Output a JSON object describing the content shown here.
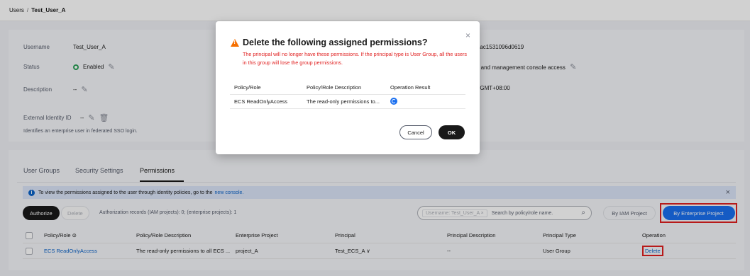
{
  "breadcrumb": {
    "parent": "Users",
    "separator": "/",
    "current": "Test_User_A"
  },
  "info": {
    "username_label": "Username",
    "username_value": "Test_User_A",
    "status_label": "Status",
    "status_value": "Enabled",
    "description_label": "Description",
    "description_value": "--",
    "external_id_label": "External Identity ID",
    "external_id_value": "--",
    "sso_hint": "Identifies an enterprise user in federated SSO login.",
    "right_id_partial": "b9aac1531096d0619",
    "right_access_partial": "ess and management console access",
    "right_time_partial": ":10 GMT+08:00"
  },
  "tabs": [
    {
      "label": "User Groups"
    },
    {
      "label": "Security Settings"
    },
    {
      "label": "Permissions"
    }
  ],
  "banner": {
    "text": "To view the permissions assigned to the user through identity policies, go to the",
    "link": "new console."
  },
  "toolbar": {
    "authorize_label": "Authorize",
    "delete_label": "Delete",
    "records": "Authorization records (IAM projects): 0; (enterprise projects): 1",
    "search_chip": "Username: Test_User_A  ×",
    "search_placeholder": "Search by policy/role name.",
    "by_iam_label": "By IAM Project",
    "by_ep_label": "By Enterprise Project"
  },
  "table": {
    "headers": [
      "Policy/Role ⊜",
      "Policy/Role Description",
      "Enterprise Project",
      "Principal",
      "Principal Description",
      "Principal Type",
      "Operation"
    ],
    "rows": [
      {
        "policy": "ECS ReadOnlyAccess",
        "description": "The read-only permissions to all ECS ...",
        "project": "project_A",
        "principal": "Test_ECS_A ∨",
        "principal_description": "--",
        "principal_type": "User Group",
        "operation": "Delete"
      }
    ]
  },
  "modal": {
    "title": "Delete the following assigned permissions?",
    "message": "The principal will no longer have these permissions. If the principal type is User Group, all the users in this group will lose the group permissions.",
    "headers": [
      "Policy/Role",
      "Policy/Role Description",
      "Operation Result"
    ],
    "row": {
      "policy": "ECS ReadOnlyAccess",
      "description": "The read-only permissions to..."
    },
    "cancel_label": "Cancel",
    "ok_label": "OK",
    "close_glyph": "×"
  },
  "icons": {
    "pencil": "✎",
    "trash": "🗑",
    "search": "⌕"
  },
  "colors": {
    "primary": "#1a6ff0",
    "danger": "#e02020",
    "success": "#2ea05a",
    "warning": "#f66f00"
  }
}
